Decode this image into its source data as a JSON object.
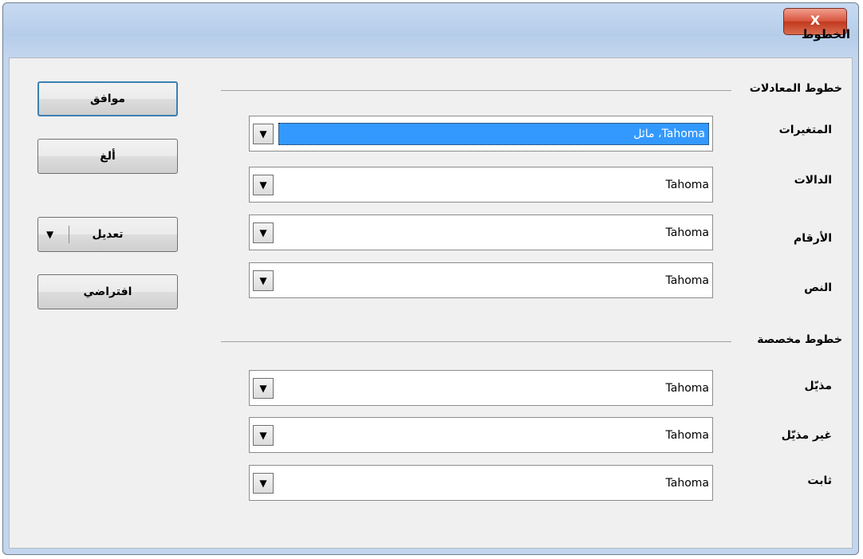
{
  "window": {
    "title": "الخطوط",
    "close_label": "X"
  },
  "formula_fonts": {
    "heading": "خطوط المعادلات",
    "rows": [
      {
        "label": "المتغيرات",
        "value": "Tahoma، مائل",
        "selected": true
      },
      {
        "label": "الدالات",
        "value": "Tahoma"
      },
      {
        "label": "الأرقام",
        "value": "Tahoma"
      },
      {
        "label": "النص",
        "value": "Tahoma"
      }
    ]
  },
  "custom_fonts": {
    "heading": "خطوط مخصصة",
    "rows": [
      {
        "label": "مذيّل",
        "value": "Tahoma"
      },
      {
        "label": "غير مذيّل",
        "value": "Tahoma"
      },
      {
        "label": "ثابت",
        "value": "Tahoma"
      }
    ]
  },
  "buttons": {
    "ok": "موافق",
    "cancel": "ألغ",
    "modify": "تعديل",
    "default": "افتراضي"
  },
  "icons": {
    "combo_arrow": "triangle-down",
    "modify_arrow": "triangle-down"
  }
}
